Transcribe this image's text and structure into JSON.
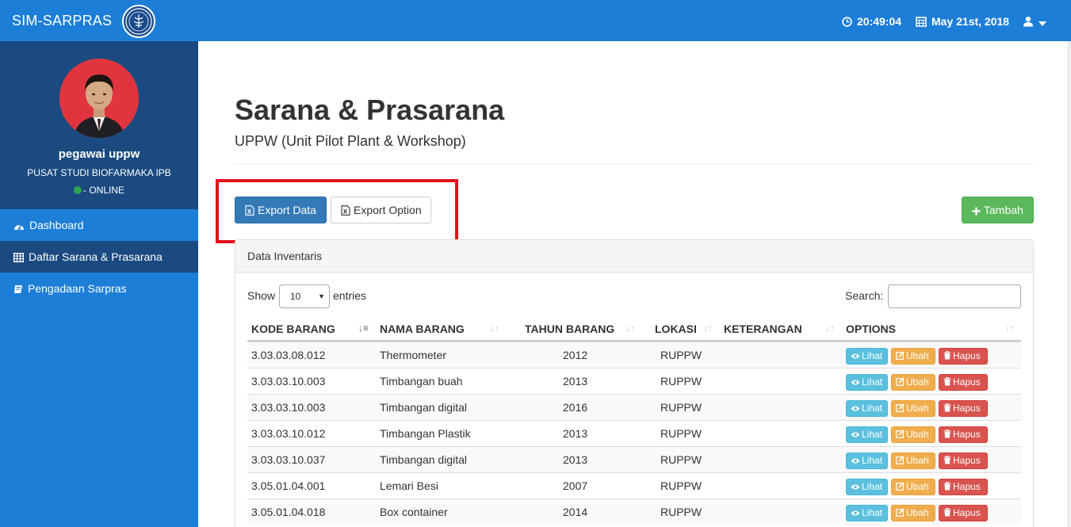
{
  "topbar": {
    "brand": "SIM-SARPRAS",
    "time": "20:49:04",
    "date": "May 21st, 2018"
  },
  "sidebar": {
    "user_name": "pegawai uppw",
    "user_org": "PUSAT STUDI BIOFARMAKA IPB",
    "user_status": "- ONLINE",
    "items": [
      {
        "label": "Dashboard",
        "icon": "dashboard-icon"
      },
      {
        "label": "Daftar Sarana & Prasarana",
        "icon": "table-icon",
        "active": true
      },
      {
        "label": "Pengadaan Sarpras",
        "icon": "book-icon"
      }
    ]
  },
  "page": {
    "title": "Sarana & Prasarana",
    "subtitle": "UPPW (Unit Pilot Plant & Workshop)"
  },
  "toolbar": {
    "export_data": "Export Data",
    "export_option": "Export Option",
    "add": "Tambah"
  },
  "panel": {
    "heading": "Data Inventaris",
    "show_label": "Show",
    "page_size": "10",
    "entries_label": "entries",
    "search_label": "Search:"
  },
  "table": {
    "columns": [
      "KODE BARANG",
      "NAMA BARANG",
      "TAHUN BARANG",
      "LOKASI",
      "KETERANGAN",
      "OPTIONS"
    ],
    "action_labels": {
      "view": "Lihat",
      "edit": "Ubah",
      "delete": "Hapus"
    },
    "rows": [
      {
        "kode": "3.03.03.08.012",
        "nama": "Thermometer",
        "tahun": "2012",
        "lokasi": "RUPPW",
        "keterangan": ""
      },
      {
        "kode": "3.03.03.10.003",
        "nama": "Timbangan buah",
        "tahun": "2013",
        "lokasi": "RUPPW",
        "keterangan": ""
      },
      {
        "kode": "3.03.03.10.003",
        "nama": "Timbangan digital",
        "tahun": "2016",
        "lokasi": "RUPPW",
        "keterangan": ""
      },
      {
        "kode": "3.03.03.10.012",
        "nama": "Timbangan Plastik",
        "tahun": "2013",
        "lokasi": "RUPPW",
        "keterangan": ""
      },
      {
        "kode": "3.03.03.10.037",
        "nama": "Timbangan digital",
        "tahun": "2013",
        "lokasi": "RUPPW",
        "keterangan": ""
      },
      {
        "kode": "3.05.01.04.001",
        "nama": "Lemari Besi",
        "tahun": "2007",
        "lokasi": "RUPPW",
        "keterangan": ""
      },
      {
        "kode": "3.05.01.04.018",
        "nama": "Box container",
        "tahun": "2014",
        "lokasi": "RUPPW",
        "keterangan": ""
      }
    ]
  },
  "colors": {
    "topbar": "#1d7ed8",
    "sidebar_dark": "#1a4a80",
    "primary": "#337ab7",
    "success": "#5cb85c",
    "info": "#5bc0de",
    "warning": "#f0ad4e",
    "danger": "#d9534f",
    "highlight": "#e2111d"
  }
}
